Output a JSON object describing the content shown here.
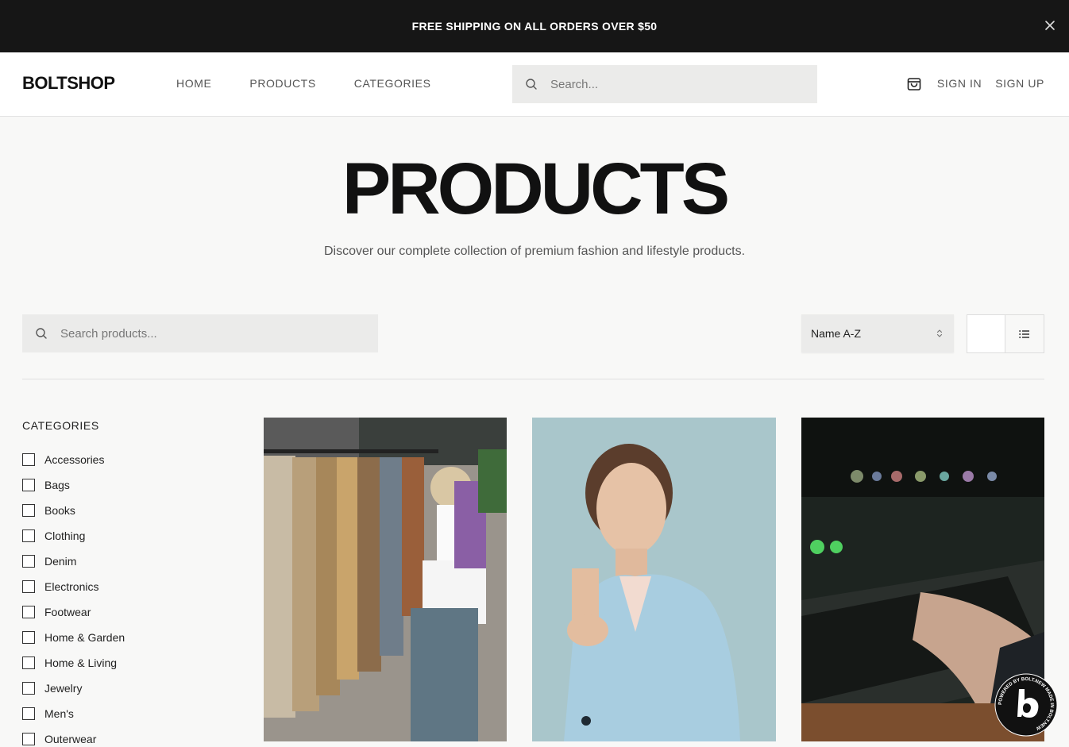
{
  "announcement": {
    "text": "FREE SHIPPING ON ALL ORDERS OVER $50"
  },
  "header": {
    "logo": "BOLTSHOP",
    "nav": [
      {
        "label": "HOME"
      },
      {
        "label": "PRODUCTS"
      },
      {
        "label": "CATEGORIES"
      }
    ],
    "search_placeholder": "Search...",
    "sign_in": "SIGN IN",
    "sign_up": "SIGN UP"
  },
  "hero": {
    "title": "PRODUCTS",
    "subtitle": "Discover our complete collection of premium fashion and lifestyle products."
  },
  "toolbar": {
    "search_placeholder": "Search products...",
    "sort_value": "Name A-Z"
  },
  "sidebar": {
    "heading": "CATEGORIES",
    "categories": [
      {
        "label": "Accessories"
      },
      {
        "label": "Bags"
      },
      {
        "label": "Books"
      },
      {
        "label": "Clothing"
      },
      {
        "label": "Denim"
      },
      {
        "label": "Electronics"
      },
      {
        "label": "Footwear"
      },
      {
        "label": "Home & Garden"
      },
      {
        "label": "Home & Living"
      },
      {
        "label": "Jewelry"
      },
      {
        "label": "Men's"
      },
      {
        "label": "Outerwear"
      }
    ]
  },
  "badge": {
    "text": "POWERED BY BOLT.NEW MADE IN BOLT.NEW"
  },
  "colors": {
    "announce_bg": "#161616",
    "accent": "#111111",
    "muted": "#555555"
  }
}
